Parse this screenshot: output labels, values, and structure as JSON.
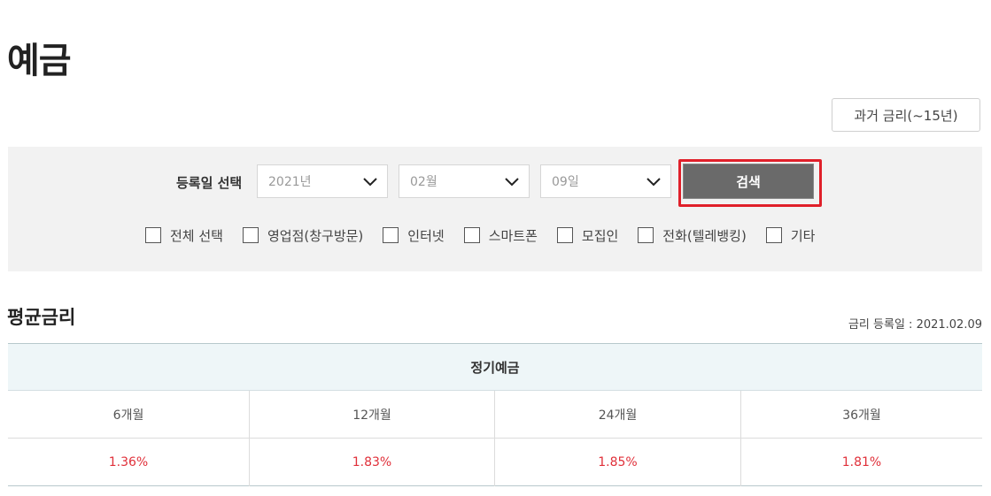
{
  "page": {
    "title": "예금"
  },
  "past_rate_button": "과거 금리(~15년)",
  "search": {
    "label": "등록일 선택",
    "year": "2021년",
    "month": "02월",
    "day": "09일",
    "button": "검색",
    "highlight_color": "#e0202a"
  },
  "channels": [
    "전체 선택",
    "영업점(창구방문)",
    "인터넷",
    "스마트폰",
    "모집인",
    "전화(텔레뱅킹)",
    "기타"
  ],
  "average": {
    "title": "평균금리",
    "reg_date_label": "금리 등록일 :",
    "reg_date": "2021.02.09",
    "group_header": "정기예금",
    "periods": [
      "6개월",
      "12개월",
      "24개월",
      "36개월"
    ],
    "rates": [
      "1.36%",
      "1.83%",
      "1.85%",
      "1.81%"
    ],
    "rate_color": "#e0303a"
  },
  "icons": {
    "dropdown": "chevron-down-icon",
    "checkbox": "checkbox-icon"
  }
}
